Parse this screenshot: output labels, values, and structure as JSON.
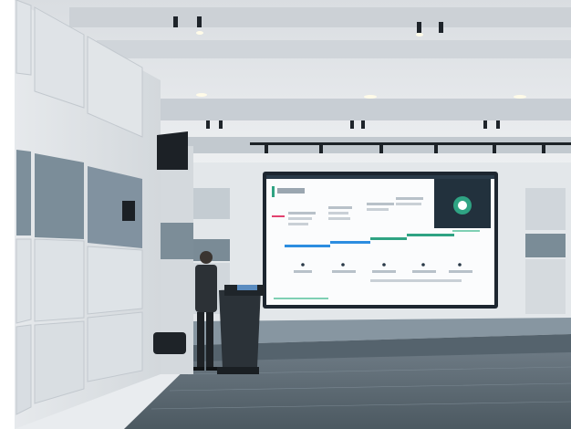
{
  "photo": {
    "description_visible_text": "",
    "slide": {
      "heading": "",
      "timeline_labels": [
        "",
        "",
        "",
        "",
        ""
      ]
    }
  },
  "colors": {
    "screen_bg": "#fdfdfe",
    "screen_border": "#1d2630",
    "accent_pink": "#e2416f",
    "accent_blue": "#2c8de0",
    "accent_green": "#2fa383",
    "stage": "#6b7c88",
    "floor": "#5c6a73",
    "wall_panel_dark": "#7b8e9a",
    "wall_panel_light": "#d8dde2"
  }
}
